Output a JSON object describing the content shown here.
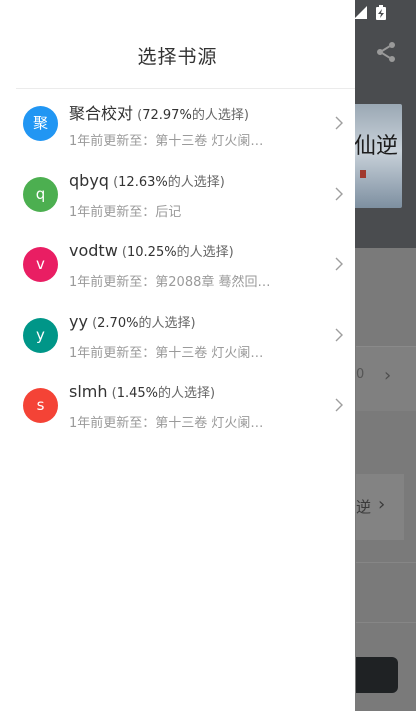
{
  "drawer": {
    "title": "选择书源",
    "sources": [
      {
        "name": "聚合校对",
        "avatar_letter": "聚",
        "avatar_color": "#2196F3",
        "paren_open": " (",
        "percent": "72.97%",
        "percent_suffix": "的人选择)",
        "update": "1年前更新至：第十三卷 灯火阑…"
      },
      {
        "name": "qbyq",
        "avatar_letter": "q",
        "avatar_color": "#4CAF50",
        "paren_open": " (",
        "percent": "12.63%",
        "percent_suffix": "的人选择)",
        "update": "1年前更新至：后记"
      },
      {
        "name": "vodtw",
        "avatar_letter": "v",
        "avatar_color": "#E91E63",
        "paren_open": " (",
        "percent": "10.25%",
        "percent_suffix": "的人选择)",
        "update": "1年前更新至：第2088章 蓦然回…"
      },
      {
        "name": "yy",
        "avatar_letter": "y",
        "avatar_color": "#009688",
        "paren_open": " (",
        "percent": "2.70%",
        "percent_suffix": "的人选择)",
        "update": "1年前更新至：第十三卷 灯火阑…"
      },
      {
        "name": "slmh",
        "avatar_letter": "s",
        "avatar_color": "#F44336",
        "paren_open": " (",
        "percent": "1.45%",
        "percent_suffix": "的人选择)",
        "update": "1年前更新至：第十三卷 灯火阑…"
      }
    ]
  },
  "background": {
    "cover_text": "仙逆",
    "partial_text": "逆",
    "partial_digit": "0"
  },
  "icons": {
    "share": "share-icon",
    "chevron": "chevron-right-icon",
    "signal": "signal-icon",
    "battery": "battery-charging-icon"
  },
  "colors": {
    "overlay": "#7a7a7a",
    "chevron": "#9e9e9e"
  }
}
